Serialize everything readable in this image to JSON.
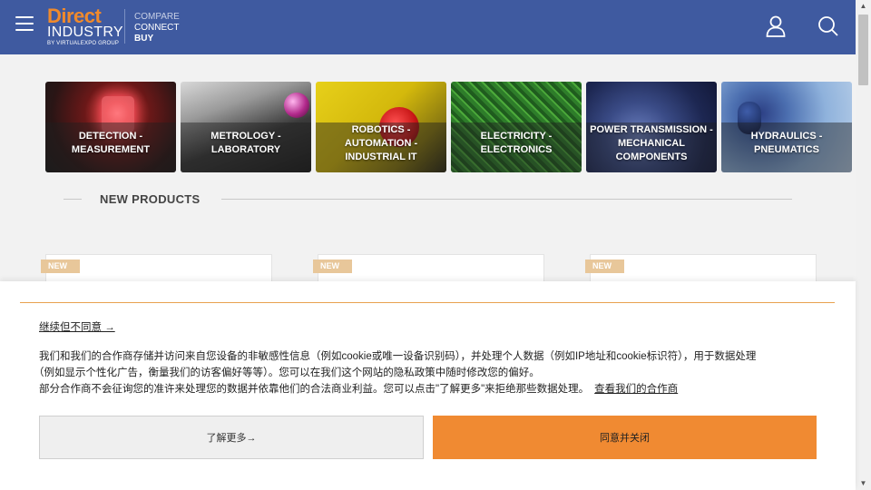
{
  "header": {
    "logo_main": "Direct",
    "logo_sub": "INDUSTRY",
    "logo_by": "BY VIRTUALEXPO GROUP",
    "tagline": [
      "COMPARE",
      "CONNECT",
      "BUY"
    ],
    "menu_icon": "hamburger-icon",
    "user_icon": "user-icon",
    "search_icon": "search-icon",
    "bg_color": "#3f5aa0",
    "accent_color": "#f08a2c"
  },
  "categories": [
    {
      "label": "DETECTION - MEASUREMENT"
    },
    {
      "label": "METROLOGY - LABORATORY"
    },
    {
      "label": "ROBOTICS - AUTOMATION - INDUSTRIAL IT"
    },
    {
      "label": "ELECTRICITY - ELECTRONICS"
    },
    {
      "label": "POWER TRANSMISSION - MECHANICAL COMPONENTS"
    },
    {
      "label": "HYDRAULICS - PNEUMATICS"
    }
  ],
  "section": {
    "title": "NEW PRODUCTS"
  },
  "products": [
    {
      "badge": "NEW"
    },
    {
      "badge": "NEW"
    },
    {
      "badge": "NEW"
    }
  ],
  "consent": {
    "continue_link": "继续但不同意 →",
    "text_line1": "我们和我们的合作商存储并访问来自您设备的非敏感性信息（例如cookie或唯一设备识别码），并处理个人数据（例如IP地址和cookie标识符），用于数据处理",
    "text_line2": "（例如显示个性化广告，衡量我们的访客偏好等等）。您可以在我们这个网站的隐私政策中随时修改您的偏好。",
    "text_line3": "部分合作商不会征询您的准许来处理您的数据并依靠他们的合法商业利益。您可以点击\"了解更多\"来拒绝那些数据处理。",
    "partners_link": "查看我们的合作商",
    "more_button": "了解更多→",
    "accept_button": "同意并关闭",
    "accept_color": "#f08a32"
  }
}
